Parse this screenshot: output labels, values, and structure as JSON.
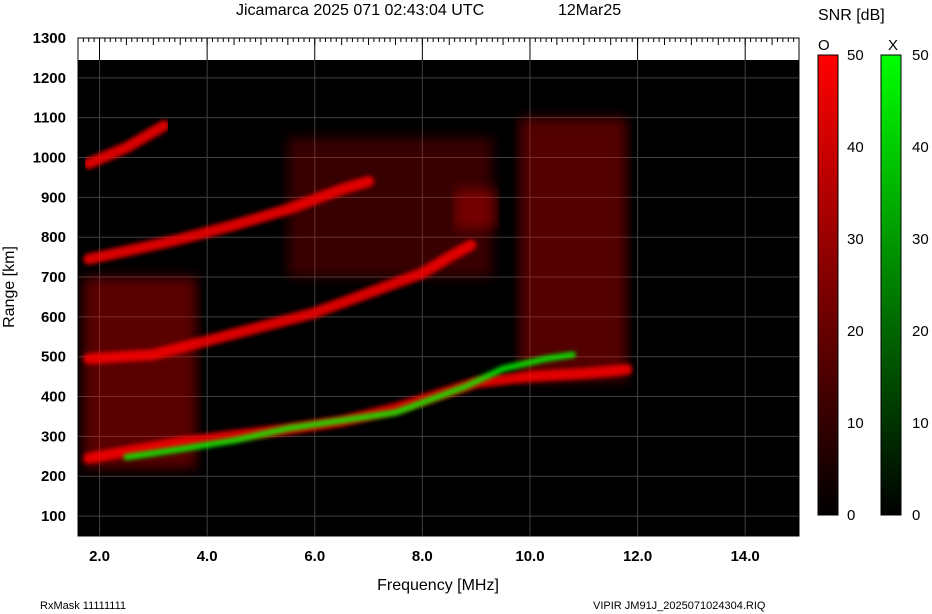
{
  "header": {
    "title": "Jicamarca 2025 071 02:43:04 UTC",
    "date": "12Mar25"
  },
  "footer": {
    "left": "RxMask 11111111",
    "right": "VIPIR  JM91J_2025071024304.RIQ"
  },
  "colorbar": {
    "title": "SNR [dB]",
    "o_label": "O",
    "x_label": "X",
    "ticks": [
      "50",
      "40",
      "30",
      "20",
      "10",
      "0"
    ]
  },
  "chart_data": {
    "type": "heatmap",
    "xlabel": "Frequency [MHz]",
    "ylabel": "Range [km]",
    "xlim": [
      1.6,
      15.0
    ],
    "ylim": [
      50,
      1300
    ],
    "x_ticks": [
      "2.0",
      "4.0",
      "6.0",
      "8.0",
      "10.0",
      "12.0",
      "14.0"
    ],
    "y_ticks": [
      "100",
      "200",
      "300",
      "400",
      "500",
      "600",
      "700",
      "800",
      "900",
      "1000",
      "1100",
      "1200",
      "1300"
    ],
    "grid": true,
    "colors": {
      "background": "#000000",
      "o_mode": "#ff0000",
      "x_mode": "#00ff00",
      "grid": "#404040"
    },
    "snr_range_db": [
      0,
      50
    ],
    "traces": [
      {
        "name": "O",
        "points": [
          [
            1.8,
            245
          ],
          [
            2.5,
            262
          ],
          [
            3.5,
            285
          ],
          [
            4.5,
            302
          ],
          [
            5.5,
            318
          ],
          [
            6.5,
            338
          ],
          [
            7.5,
            370
          ],
          [
            8.3,
            405
          ],
          [
            9.0,
            435
          ],
          [
            10.0,
            450
          ],
          [
            11.0,
            458
          ],
          [
            11.8,
            468
          ]
        ]
      },
      {
        "name": "X",
        "points": [
          [
            2.5,
            248
          ],
          [
            3.5,
            268
          ],
          [
            4.5,
            290
          ],
          [
            5.5,
            320
          ],
          [
            6.5,
            340
          ],
          [
            7.5,
            360
          ],
          [
            8.2,
            395
          ],
          [
            8.8,
            425
          ],
          [
            9.5,
            470
          ],
          [
            10.3,
            495
          ],
          [
            10.8,
            505
          ]
        ]
      },
      {
        "name": "O",
        "points": [
          [
            1.8,
            495
          ],
          [
            3.0,
            505
          ],
          [
            4.0,
            540
          ],
          [
            5.0,
            575
          ],
          [
            6.0,
            610
          ],
          [
            7.0,
            660
          ],
          [
            8.0,
            710
          ],
          [
            8.5,
            750
          ],
          [
            8.9,
            780
          ]
        ]
      },
      {
        "name": "O",
        "points": [
          [
            1.8,
            745
          ],
          [
            2.5,
            765
          ],
          [
            3.5,
            795
          ],
          [
            4.5,
            830
          ],
          [
            5.5,
            870
          ],
          [
            6.5,
            920
          ],
          [
            7.0,
            940
          ]
        ]
      },
      {
        "name": "O",
        "points": [
          [
            1.8,
            985
          ],
          [
            2.5,
            1025
          ],
          [
            3.2,
            1080
          ]
        ]
      }
    ]
  }
}
